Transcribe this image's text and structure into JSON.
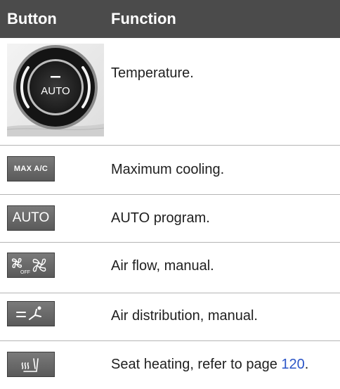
{
  "table": {
    "header": {
      "button": "Button",
      "function": "Function"
    },
    "rows": [
      {
        "icon": "temperature-knob-icon",
        "icon_text": "AUTO",
        "function": "Temperature."
      },
      {
        "icon": "max-ac-icon",
        "icon_text": "MAX A/C",
        "function": "Maximum cooling."
      },
      {
        "icon": "auto-icon",
        "icon_text": "AUTO",
        "function": "AUTO program."
      },
      {
        "icon": "fan-icon",
        "icon_text": "OFF",
        "function": "Air flow, manual."
      },
      {
        "icon": "air-distribution-icon",
        "icon_text": "",
        "function": "Air distribution, manual."
      },
      {
        "icon": "seat-heating-icon",
        "icon_text": "",
        "function_prefix": "Seat heating, refer to page ",
        "function_link": "120",
        "function_suffix": "."
      }
    ]
  }
}
